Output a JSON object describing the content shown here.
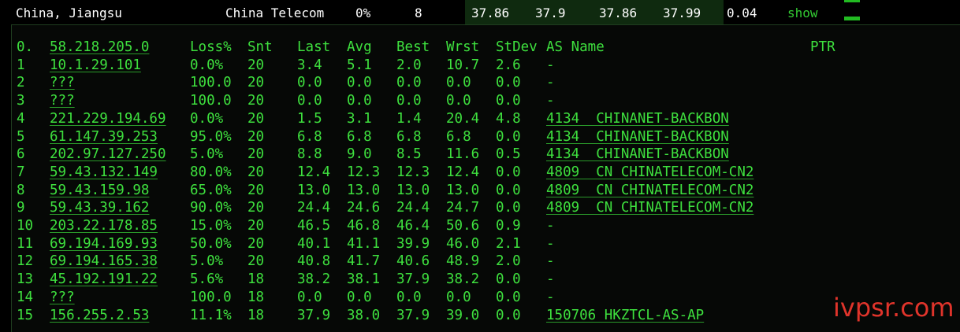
{
  "summary": {
    "location": "China, Jiangsu",
    "isp": "China Telecom",
    "loss": "0%",
    "sent": "8",
    "last": "37.86",
    "avg": "37.9",
    "best": "37.86",
    "worst": "37.99",
    "stdev": "0.04",
    "action": "show",
    "accent_color": "#33cc33"
  },
  "table": {
    "headers": {
      "hop": "0.",
      "host": "58.218.205.0",
      "loss": "Loss%",
      "snt": "Snt",
      "last": "Last",
      "avg": "Avg",
      "best": "Best",
      "wrst": "Wrst",
      "stdev": "StDev",
      "asname": "AS Name",
      "ptr": "PTR"
    },
    "rows": [
      {
        "hop": "1",
        "host": "10.1.29.101",
        "loss": "0.0%",
        "snt": "20",
        "last": "3.4",
        "avg": "5.1",
        "best": "2.0",
        "wrst": "10.7",
        "stdev": "2.6",
        "asname": "-"
      },
      {
        "hop": "2",
        "host": "???",
        "loss": "100.0",
        "snt": "20",
        "last": "0.0",
        "avg": "0.0",
        "best": "0.0",
        "wrst": "0.0",
        "stdev": "0.0",
        "asname": "-"
      },
      {
        "hop": "3",
        "host": "???",
        "loss": "100.0",
        "snt": "20",
        "last": "0.0",
        "avg": "0.0",
        "best": "0.0",
        "wrst": "0.0",
        "stdev": "0.0",
        "asname": "-"
      },
      {
        "hop": "4",
        "host": "221.229.194.69",
        "loss": "0.0%",
        "snt": "20",
        "last": "1.5",
        "avg": "3.1",
        "best": "1.4",
        "wrst": "20.4",
        "stdev": "4.8",
        "asname": "4134  CHINANET-BACKBON"
      },
      {
        "hop": "5",
        "host": "61.147.39.253",
        "loss": "95.0%",
        "snt": "20",
        "last": "6.8",
        "avg": "6.8",
        "best": "6.8",
        "wrst": "6.8",
        "stdev": "0.0",
        "asname": "4134  CHINANET-BACKBON"
      },
      {
        "hop": "6",
        "host": "202.97.127.250",
        "loss": "5.0%",
        "snt": "20",
        "last": "8.8",
        "avg": "9.0",
        "best": "8.5",
        "wrst": "11.6",
        "stdev": "0.5",
        "asname": "4134  CHINANET-BACKBON"
      },
      {
        "hop": "7",
        "host": "59.43.132.149",
        "loss": "80.0%",
        "snt": "20",
        "last": "12.4",
        "avg": "12.3",
        "best": "12.3",
        "wrst": "12.4",
        "stdev": "0.0",
        "asname": "4809  CN CHINATELECOM-CN2"
      },
      {
        "hop": "8",
        "host": "59.43.159.98",
        "loss": "65.0%",
        "snt": "20",
        "last": "13.0",
        "avg": "13.0",
        "best": "13.0",
        "wrst": "13.0",
        "stdev": "0.0",
        "asname": "4809  CN CHINATELECOM-CN2"
      },
      {
        "hop": "9",
        "host": "59.43.39.162",
        "loss": "90.0%",
        "snt": "20",
        "last": "24.4",
        "avg": "24.6",
        "best": "24.4",
        "wrst": "24.7",
        "stdev": "0.0",
        "asname": "4809  CN CHINATELECOM-CN2"
      },
      {
        "hop": "10",
        "host": "203.22.178.85",
        "loss": "15.0%",
        "snt": "20",
        "last": "46.5",
        "avg": "46.8",
        "best": "46.4",
        "wrst": "50.6",
        "stdev": "0.9",
        "asname": "-"
      },
      {
        "hop": "11",
        "host": "69.194.169.93",
        "loss": "50.0%",
        "snt": "20",
        "last": "40.1",
        "avg": "41.1",
        "best": "39.9",
        "wrst": "46.0",
        "stdev": "2.1",
        "asname": "-"
      },
      {
        "hop": "12",
        "host": "69.194.165.38",
        "loss": "5.0%",
        "snt": "20",
        "last": "40.8",
        "avg": "41.7",
        "best": "40.6",
        "wrst": "48.9",
        "stdev": "2.0",
        "asname": "-"
      },
      {
        "hop": "13",
        "host": "45.192.191.22",
        "loss": "5.6%",
        "snt": "18",
        "last": "38.2",
        "avg": "38.1",
        "best": "37.9",
        "wrst": "38.2",
        "stdev": "0.0",
        "asname": "-"
      },
      {
        "hop": "14",
        "host": "???",
        "loss": "100.0",
        "snt": "18",
        "last": "0.0",
        "avg": "0.0",
        "best": "0.0",
        "wrst": "0.0",
        "stdev": "0.0",
        "asname": "-"
      },
      {
        "hop": "15",
        "host": "156.255.2.53",
        "loss": "11.1%",
        "snt": "18",
        "last": "37.9",
        "avg": "38.0",
        "best": "37.9",
        "wrst": "39.0",
        "stdev": "0.0",
        "asname": "150706 HKZTCL-AS-AP"
      }
    ]
  },
  "watermark": "ivpsr.com",
  "colors": {
    "text_green": "#3ee03e",
    "watermark_red": "#e0342b"
  }
}
